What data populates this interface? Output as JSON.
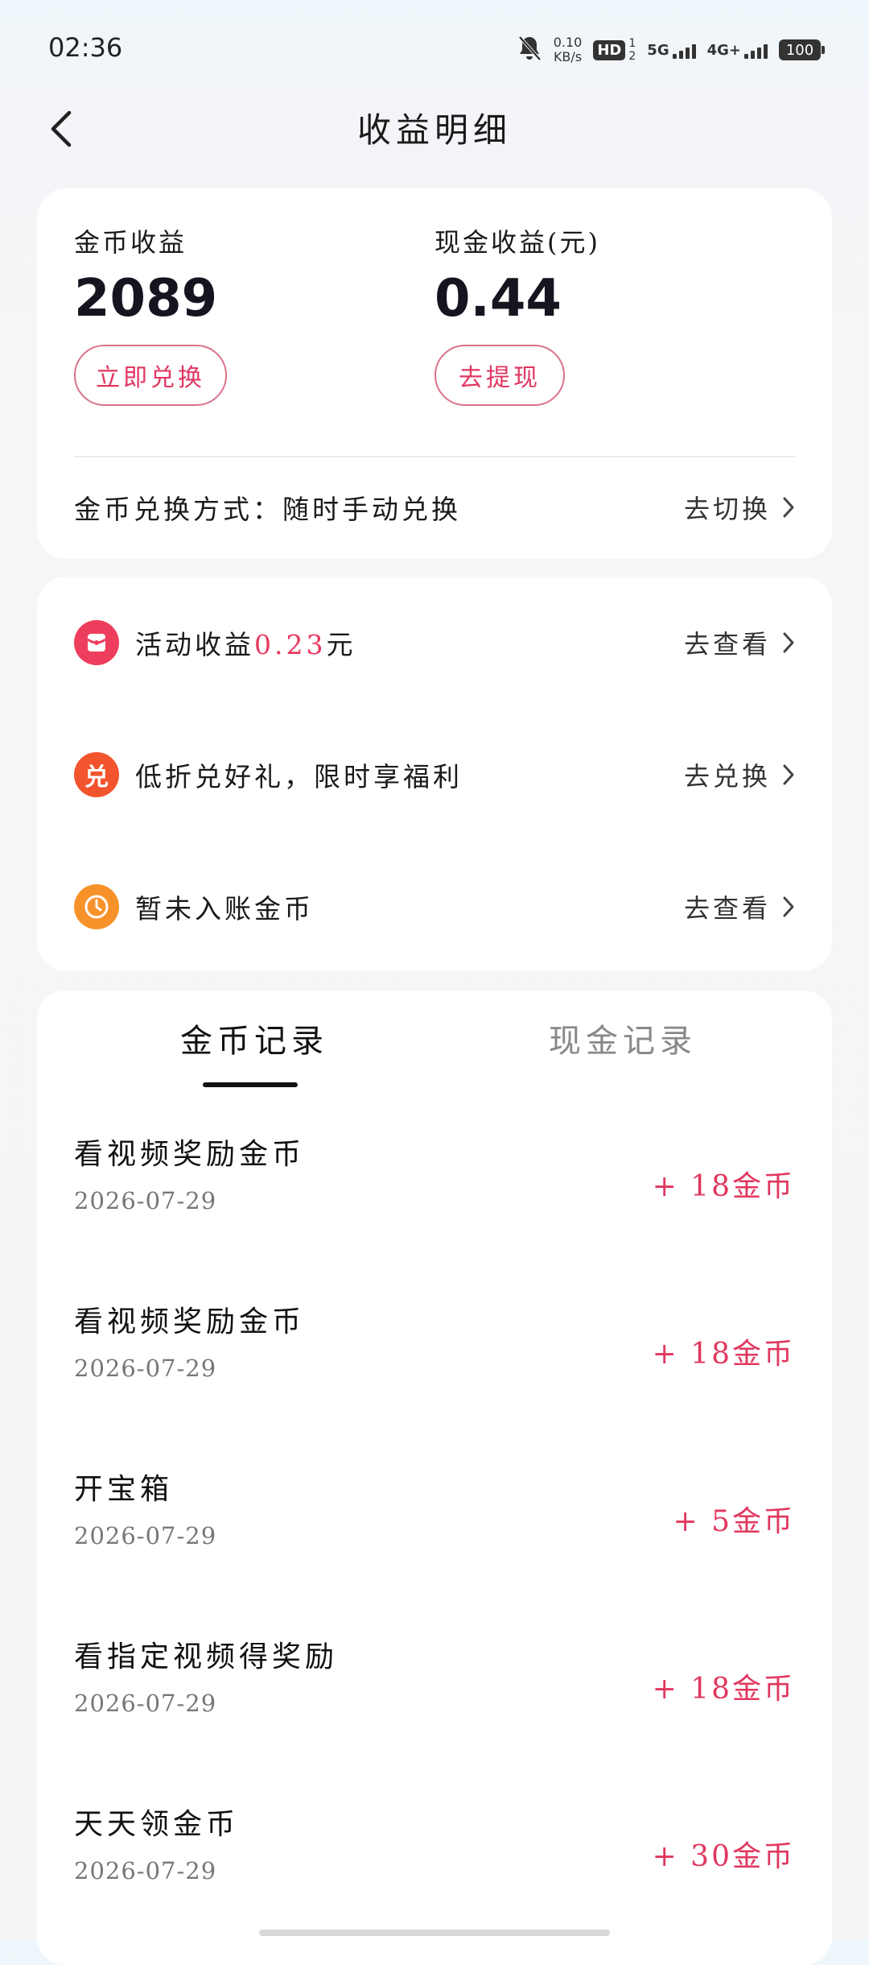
{
  "status_bar": {
    "time": "02:36",
    "net_speed_value": "0.10",
    "net_speed_unit": "KB/s",
    "hd_badge": "HD",
    "hd_sub_top": "1",
    "hd_sub_bottom": "2",
    "net_type_1": "5G",
    "net_type_2": "4G+",
    "battery": "100",
    "icons": [
      "bell-muted-icon",
      "signal-bars-icon",
      "battery-icon"
    ]
  },
  "nav": {
    "title": "收益明细",
    "back_icon": "chevron-left-icon"
  },
  "earnings": {
    "coin_label": "金币收益",
    "coin_value": "2089",
    "coin_button": "立即兑换",
    "cash_label": "现金收益(元)",
    "cash_value": "0.44",
    "cash_button": "去提现",
    "exchange_mode": "金币兑换方式：随时手动兑换",
    "switch_link": "去切换",
    "accent_color": "#e8385f"
  },
  "actions": [
    {
      "prefix": "活动收益",
      "highlight": "0.23",
      "suffix": "元",
      "link": "去查看",
      "icon": "red-envelope-icon"
    },
    {
      "text": "低折兑好礼，限时享福利",
      "link": "去兑换",
      "icon": "exchange-badge-icon",
      "glyph": "兑"
    },
    {
      "text": "暂未入账金币",
      "link": "去查看",
      "icon": "clock-icon"
    }
  ],
  "records": {
    "tabs": [
      {
        "label": "金币记录",
        "active": true
      },
      {
        "label": "现金记录",
        "active": false
      }
    ],
    "items": [
      {
        "title": "看视频奖励金币",
        "date": "2026-07-29",
        "amount": "+ 18金币"
      },
      {
        "title": "看视频奖励金币",
        "date": "2026-07-29",
        "amount": "+ 18金币"
      },
      {
        "title": "开宝箱",
        "date": "2026-07-29",
        "amount": "+ 5金币"
      },
      {
        "title": "看指定视频得奖励",
        "date": "2026-07-29",
        "amount": "+ 18金币"
      },
      {
        "title": "天天领金币",
        "date": "2026-07-29",
        "amount": "+ 30金币"
      }
    ]
  }
}
